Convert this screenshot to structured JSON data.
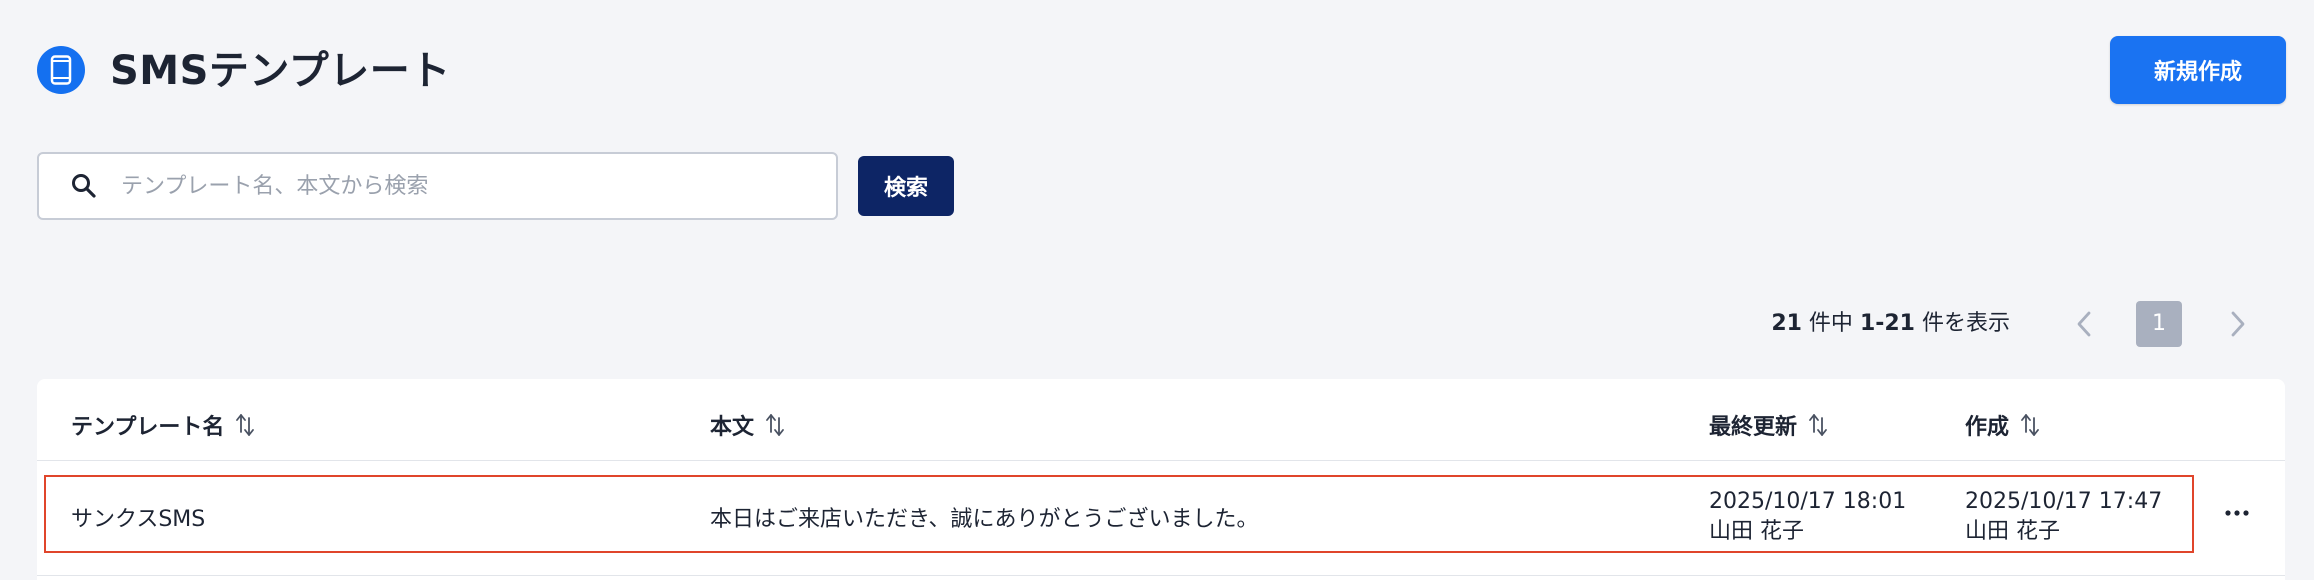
{
  "header": {
    "title": "SMSテンプレート",
    "new_button_label": "新規作成",
    "icon": "mobile-phone-icon"
  },
  "search": {
    "placeholder": "テンプレート名、本文から検索",
    "value": "",
    "button_label": "検索"
  },
  "pagination": {
    "total": "21",
    "total_suffix": " 件中 ",
    "range": "1-21",
    "range_suffix": " 件を表示",
    "current_page": "1"
  },
  "table": {
    "columns": [
      {
        "label": "テンプレート名"
      },
      {
        "label": "本文"
      },
      {
        "label": "最終更新"
      },
      {
        "label": "作成"
      }
    ],
    "rows": [
      {
        "name": "サンクスSMS",
        "body": "本日はご来店いただき、誠にありがとうございました。",
        "updated_at": "2025/10/17 18:01",
        "updated_by": "山田 花子",
        "created_at": "2025/10/17 17:47",
        "created_by": "山田 花子"
      }
    ]
  },
  "colors": {
    "primary": "#1a73f2",
    "search_button": "#0d2565",
    "highlight": "#e0452b",
    "background": "#f4f5f8"
  }
}
